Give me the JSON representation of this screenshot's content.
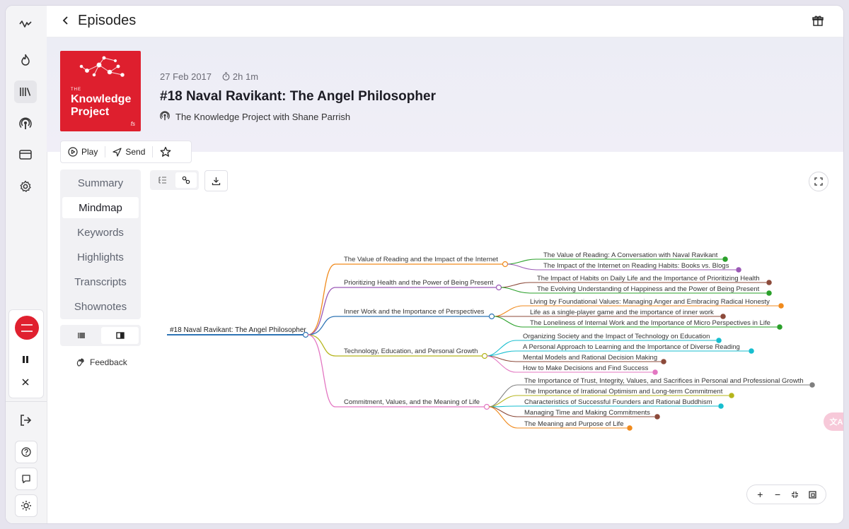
{
  "header": {
    "back_icon": "chevron-left-icon",
    "title": "Episodes",
    "gift_icon": "gift-icon"
  },
  "episode": {
    "date": "27 Feb 2017",
    "duration": "2h 1m",
    "title": "#18 Naval Ravikant: The Angel Philosopher",
    "show": "The Knowledge Project with Shane Parrish",
    "cover": {
      "small_label": "THE",
      "name_line1": "Knowledge",
      "name_line2": "Project",
      "mark": "fs",
      "color": "#de1f2e"
    }
  },
  "actions": {
    "play": "Play",
    "send": "Send"
  },
  "tabs": [
    {
      "label": "Summary",
      "active": false
    },
    {
      "label": "Mindmap",
      "active": true
    },
    {
      "label": "Keywords",
      "active": false
    },
    {
      "label": "Highlights",
      "active": false
    },
    {
      "label": "Transcripts",
      "active": false
    },
    {
      "label": "Shownotes",
      "active": false
    }
  ],
  "feedback": "Feedback",
  "mindmap": {
    "root": "#18 Naval Ravikant: The Angel Philosopher",
    "branches": [
      {
        "label": "The Value of Reading and the Impact of the Internet",
        "color": "#f08a1c",
        "children": [
          {
            "label": "The Value of Reading: A Conversation with Naval Ravikant",
            "color": "#2aa02a"
          },
          {
            "label": "The Impact of the Internet on Reading Habits: Books vs. Blogs",
            "color": "#9b59b6"
          }
        ]
      },
      {
        "label": "Prioritizing Health and the Power of Being Present",
        "color": "#9b59b6",
        "children": [
          {
            "label": "The Impact of Habits on Daily Life and the Importance of Prioritizing Health",
            "color": "#8c4a3a"
          },
          {
            "label": "The Evolving Understanding of Happiness and the Power of Being Present",
            "color": "#2aa02a"
          }
        ]
      },
      {
        "label": "Inner Work and the Importance of Perspectives",
        "color": "#2e74b5",
        "children": [
          {
            "label": "Living by Foundational Values: Managing Anger and Embracing Radical Honesty",
            "color": "#f08a1c"
          },
          {
            "label": "Life as a single-player game and the importance of inner work",
            "color": "#8c4a3a"
          },
          {
            "label": "The Loneliness of Internal Work and the Importance of Micro Perspectives in Life",
            "color": "#2aa02a"
          }
        ]
      },
      {
        "label": "Technology, Education, and Personal Growth",
        "color": "#b5b51c",
        "children": [
          {
            "label": "Organizing Society and the Impact of Technology on Education",
            "color": "#17becf"
          },
          {
            "label": "A Personal Approach to Learning and the Importance of Diverse Reading",
            "color": "#17becf"
          },
          {
            "label": "Mental Models and Rational Decision Making",
            "color": "#8c4a3a"
          },
          {
            "label": "How to Make Decisions and Find Success",
            "color": "#e377c2"
          }
        ]
      },
      {
        "label": "Commitment, Values, and the Meaning of Life",
        "color": "#e377c2",
        "children": [
          {
            "label": "The Importance of Trust, Integrity, Values, and Sacrifices in Personal and Professional Growth",
            "color": "#7f7f7f"
          },
          {
            "label": "The Importance of Irrational Optimism and Long-term Commitment",
            "color": "#b5b51c"
          },
          {
            "label": "Characteristics of Successful Founders and Rational Buddhism",
            "color": "#17becf"
          },
          {
            "label": "Managing Time and Making Commitments",
            "color": "#8c4a3a"
          },
          {
            "label": "The Meaning and Purpose of Life",
            "color": "#f08a1c"
          }
        ]
      }
    ]
  },
  "zoom_controls": {
    "zoom_in": "+",
    "zoom_out": "−"
  },
  "translate_fab": "文A"
}
